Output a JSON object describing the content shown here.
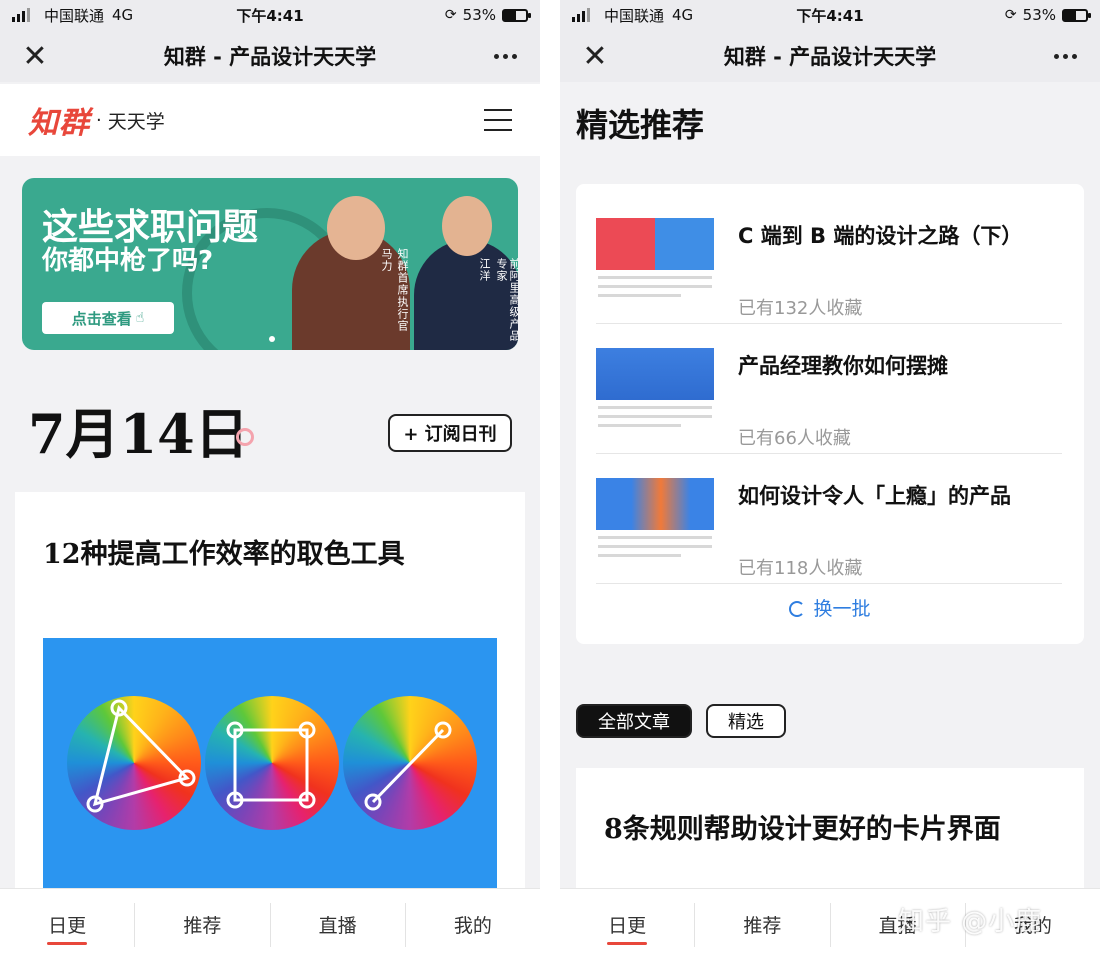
{
  "status_bar": {
    "carrier": "中国联通",
    "network": "4G",
    "time": "下午4:41",
    "battery": "53%",
    "battery_level": 0.53
  },
  "nav": {
    "title": "知群 - 产品设计天天学"
  },
  "brand": {
    "logo": "知群",
    "separator": "·",
    "subtitle": "天天学",
    "accent_color": "#e8473b"
  },
  "banner": {
    "title_line1": "这些求职问题",
    "title_line2": "你都中枪了吗?",
    "button_label": "点击查看",
    "person1_name": "马力",
    "person1_role": "知群首席执行官",
    "person2_name": "江洋",
    "person2_role": "前阿里高级产品专家",
    "color": "#3aa98f"
  },
  "daily": {
    "date": "7月14日",
    "subscribe_label": "+ 订阅日刊"
  },
  "article": {
    "title": "12种提高工作效率的取色工具"
  },
  "recommend": {
    "heading": "精选推荐",
    "items": [
      {
        "title": "C 端到 B 端的设计之路（下）",
        "count": "已有132人收藏"
      },
      {
        "title": "产品经理教你如何摆摊",
        "count": "已有66人收藏"
      },
      {
        "title": "如何设计令人「上瘾」的产品",
        "count": "已有118人收藏"
      }
    ],
    "refresh_label": "换一批"
  },
  "filters": {
    "all_label": "全部文章",
    "featured_label": "精选"
  },
  "article2": {
    "title": "8条规则帮助设计更好的卡片界面"
  },
  "tabs": [
    "日更",
    "推荐",
    "直播",
    "我的"
  ],
  "watermark": "知乎 @小鹿"
}
